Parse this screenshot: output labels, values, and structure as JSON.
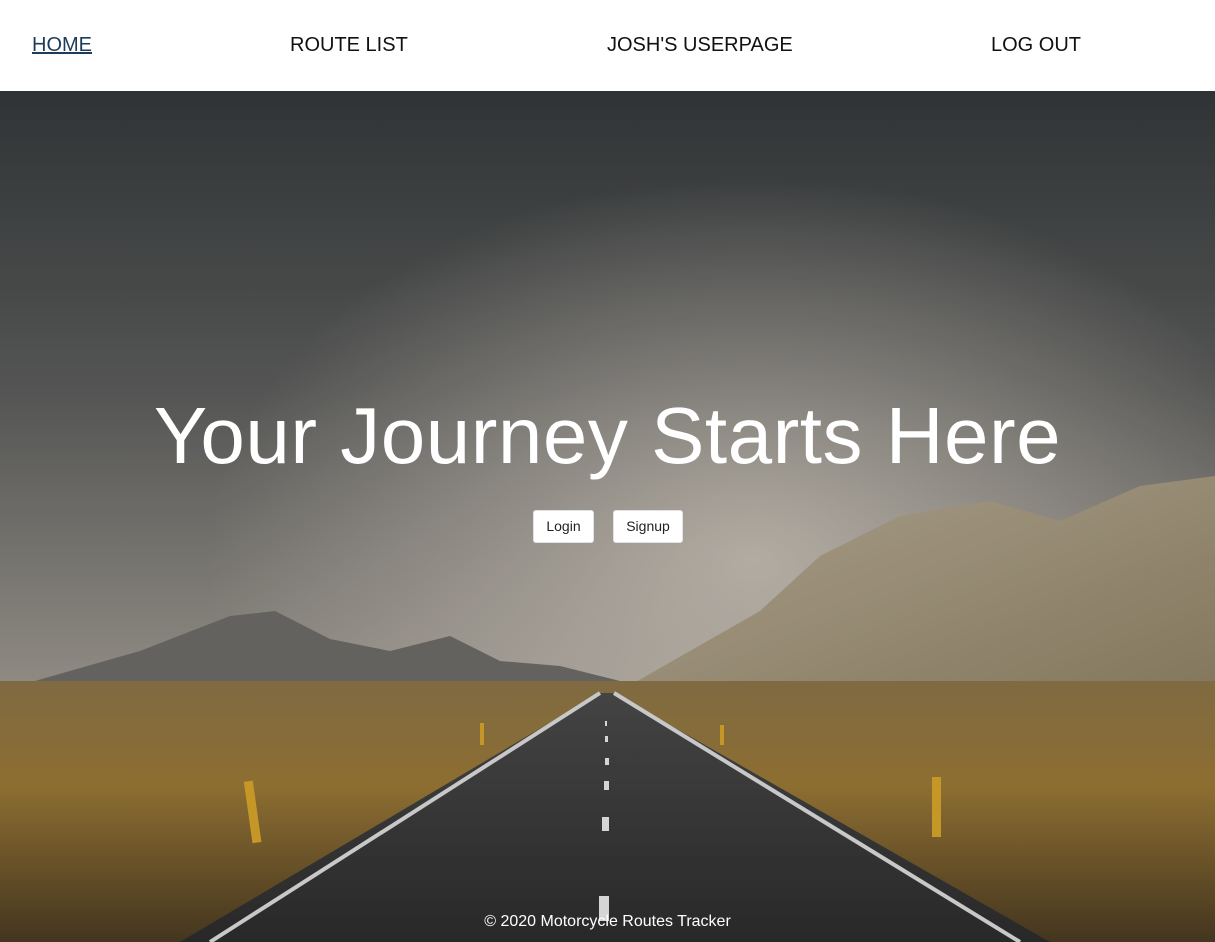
{
  "nav": {
    "home": "HOME",
    "route_list": "ROUTE LIST",
    "userpage": "JOSH'S USERPAGE",
    "logout": "LOG OUT"
  },
  "hero": {
    "title": "Your Journey Starts Here",
    "login_label": "Login",
    "signup_label": "Signup",
    "background_image": "road-landscape-photo"
  },
  "footer": {
    "text": "© 2020 Motorcycle Routes Tracker"
  },
  "colors": {
    "nav_background": "#ffffff",
    "active_link": "#1d3c5a",
    "hero_text": "#ffffff"
  }
}
